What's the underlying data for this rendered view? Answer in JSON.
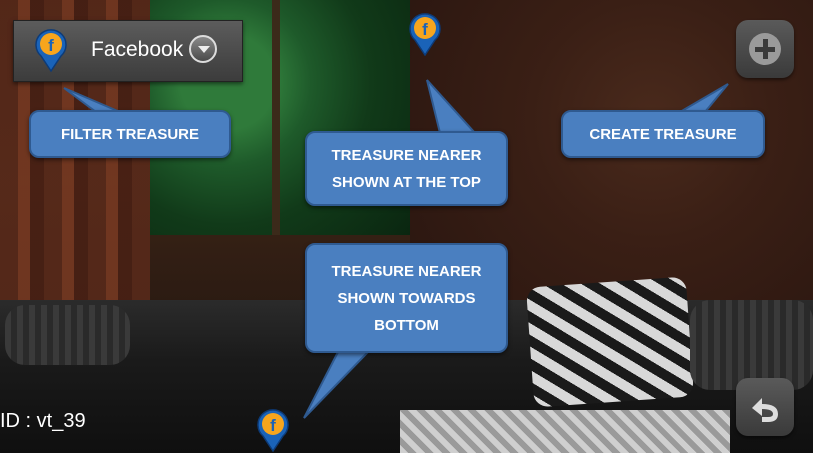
{
  "filter": {
    "label": "Facebook"
  },
  "callouts": {
    "filter": "FILTER TREASURE",
    "create": "CREATE TREASURE",
    "top": [
      "TREASURE NEARER",
      "SHOWN AT THE TOP"
    ],
    "bottom": [
      "TREASURE NEARER",
      "SHOWN TOWARDS",
      "BOTTOM"
    ]
  },
  "status": {
    "id_text": "ID : vt_39"
  },
  "icons": {
    "facebook_pin": "facebook-pin-icon",
    "add": "add-icon",
    "back": "back-icon",
    "dropdown": "chevron-down-icon"
  },
  "colors": {
    "callout": "#4a7fc0",
    "pin_blue": "#1a63b8",
    "pin_orange": "#f7a51d"
  }
}
